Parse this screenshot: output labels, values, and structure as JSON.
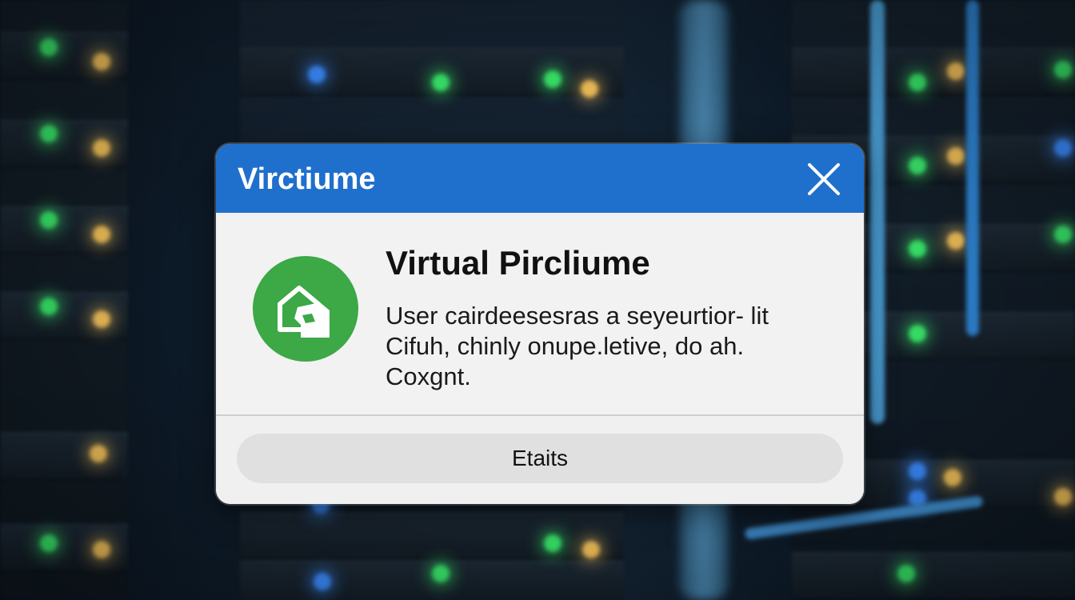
{
  "dialog": {
    "title": "Virctiume",
    "close_icon": "close-icon",
    "heading": "Virtual Pircliume",
    "message_lines": [
      "User cairdeesesras a seyeurtior- lit",
      "Cifuh, chinly onupe.letive, do ah.",
      "Coxgnt."
    ],
    "app_icon": "home-document-icon",
    "action_button_label": "Etaits"
  },
  "colors": {
    "titlebar": "#1f6fcd",
    "app_icon_bg": "#3ca846",
    "button_bg": "#e0e0e0"
  }
}
